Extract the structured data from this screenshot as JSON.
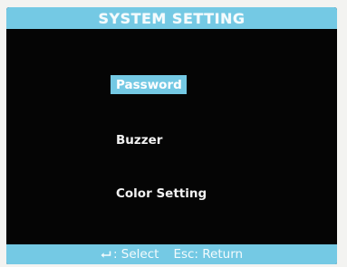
{
  "screen": {
    "title": "SYSTEM SETTING"
  },
  "menu": {
    "selected_index": 0,
    "items": [
      {
        "label": "Password"
      },
      {
        "label": "Buzzer"
      },
      {
        "label": "Color Setting"
      }
    ]
  },
  "status_bar": {
    "select_icon": "enter-icon",
    "select_hint": ": Select",
    "return_hint": "Esc: Return"
  },
  "colors": {
    "accent": "#74c9e4",
    "background": "#050505",
    "text": "#f2f2f2"
  }
}
